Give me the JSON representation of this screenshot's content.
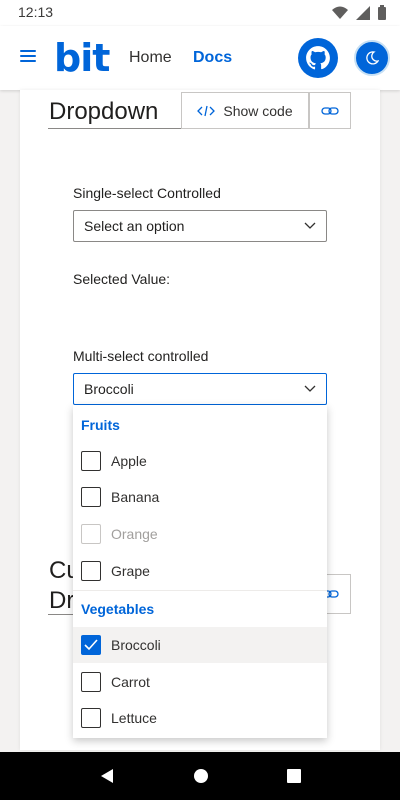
{
  "status_bar": {
    "time": "12:13"
  },
  "header": {
    "logo": "bit",
    "nav": {
      "home": "Home",
      "docs": "Docs"
    }
  },
  "section1": {
    "title": "Dropdown",
    "show_code": "Show code"
  },
  "single_select": {
    "label": "Single-select Controlled",
    "placeholder": "Select an option",
    "selected_value_label": "Selected Value:"
  },
  "multi_select": {
    "label": "Multi-select controlled",
    "value": "Broccoli",
    "groups": [
      {
        "header": "Fruits",
        "options": [
          {
            "label": "Apple",
            "checked": false,
            "disabled": false
          },
          {
            "label": "Banana",
            "checked": false,
            "disabled": false
          },
          {
            "label": "Orange",
            "checked": false,
            "disabled": true
          },
          {
            "label": "Grape",
            "checked": false,
            "disabled": false
          }
        ]
      },
      {
        "header": "Vegetables",
        "options": [
          {
            "label": "Broccoli",
            "checked": true,
            "disabled": false
          },
          {
            "label": "Carrot",
            "checked": false,
            "disabled": false
          },
          {
            "label": "Lettuce",
            "checked": false,
            "disabled": false
          }
        ]
      }
    ]
  },
  "section2": {
    "title": "Cu Dr"
  },
  "colors": {
    "accent": "#0065d9",
    "text": "#201f1e",
    "border": "#8a8886"
  }
}
